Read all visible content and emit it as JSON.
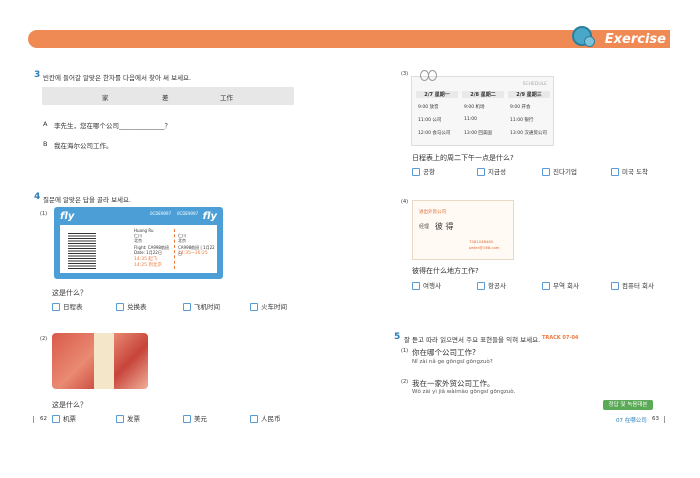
{
  "header": {
    "title": "Exercise"
  },
  "q3": {
    "num": "3",
    "instruction": "빈칸에 들어갈 알맞은 한자를 다음에서 찾아 써 보세요.",
    "choices": [
      "家",
      "差",
      "工作"
    ],
    "line_a_label": "A",
    "line_a": "李先生，您在哪个公司______________？",
    "line_b_label": "B",
    "line_b": "我在海尔公司工作。"
  },
  "q4": {
    "num": "4",
    "instruction": "질문에 알맞은 답을 골라 보세요.",
    "sub1_num": "(1)",
    "ticket": {
      "brand_left": "fly",
      "brand_right": "fly",
      "code_left": "0CDE9097",
      "code_right": "0CDE9097",
      "name": "Huang Ru",
      "from": "仁川",
      "to": "北京",
      "flight": "Flight: CA998航班",
      "date": "Date: 1月22日",
      "time": "14:35 起飞",
      "time2": "14:25 到北京",
      "r_from": "仁川",
      "r_to": "北京",
      "r_flight": "CA998航班 | 1月22日",
      "r_time": "14:35~16:25"
    },
    "q1_question": "这是什么？",
    "q1_options": [
      "日程表",
      "兑换表",
      "飞机时间",
      "火车时间"
    ],
    "sub2_num": "(2)",
    "q2_question": "这是什么？",
    "q2_options": [
      "机票",
      "发票",
      "美元",
      "人民币"
    ]
  },
  "right3": {
    "num": "(3)",
    "schedule_label": "SCHEDULE",
    "days": [
      "2/7 星期一",
      "2/8 星期二",
      "2/9 星期三"
    ],
    "rows": [
      [
        "9:00  放音",
        "9:00  机场",
        "9:00  开会"
      ],
      [
        "11:00  公司",
        "11:00",
        "11:00  银行"
      ],
      [
        "12:00  会马公司",
        "13:00  回美国",
        "13:00  汉通贸公司"
      ]
    ],
    "question": "日程表上的周二下午一点是什么?",
    "options": [
      "공항",
      "지금성",
      "진다기업",
      "미국 도착"
    ]
  },
  "right4": {
    "num": "(4)",
    "card_company": "进出外贸公司",
    "card_title": "经理",
    "card_name": "彼 得",
    "card_phone": "7581048465",
    "card_email": "peter@168.com",
    "question": "彼得在什么地方工作?",
    "options": [
      "여행사",
      "항공사",
      "무역 회사",
      "컴퓨터 회사"
    ]
  },
  "q5": {
    "num": "5",
    "instruction": "잘 듣고 따라 읽으면서 주요 표현들을 익혀 보세요.",
    "track": "TRACK 07-04",
    "items": [
      {
        "num": "(1)",
        "hanzi": "你在哪个公司工作?",
        "pinyin": "Nǐ zài nǎ ge gōngsī gōngzuò?"
      },
      {
        "num": "(2)",
        "hanzi": "我在一家外贸公司工作。",
        "pinyin": "Wǒ zài yì jiā wàimào gōngsī gōngzuò."
      }
    ]
  },
  "footer": {
    "tag_text": "정답 및 녹음대본",
    "tag_page": "p123",
    "left_page": "62",
    "right_chapter": "07 在哪公司",
    "right_page": "63"
  }
}
